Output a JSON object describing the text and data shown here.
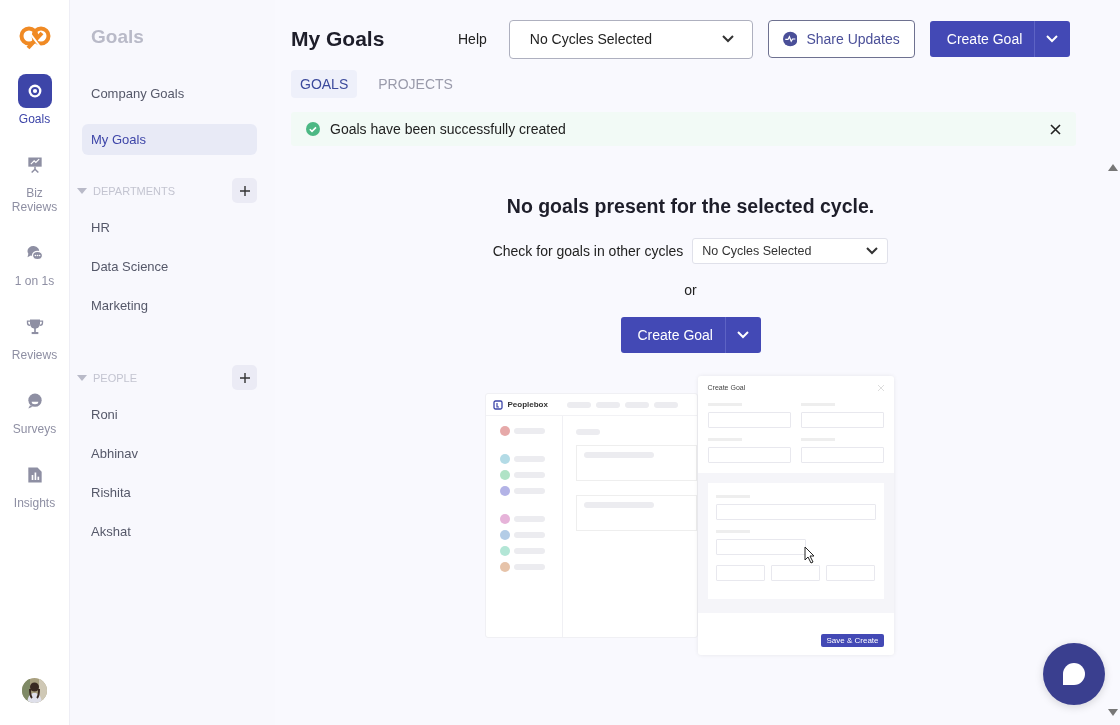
{
  "rail": {
    "items": [
      {
        "label": "Goals",
        "kind": "target",
        "selected": true
      },
      {
        "label": "Biz Reviews",
        "kind": "presentation",
        "selected": false
      },
      {
        "label": "1 on 1s",
        "kind": "chat",
        "selected": false
      },
      {
        "label": "Reviews",
        "kind": "trophy",
        "selected": false
      },
      {
        "label": "Surveys",
        "kind": "survey",
        "selected": false
      },
      {
        "label": "Insights",
        "kind": "chart",
        "selected": false
      }
    ]
  },
  "sidebar": {
    "title": "Goals",
    "items": [
      {
        "label": "Company Goals",
        "selected": false
      },
      {
        "label": "My Goals",
        "selected": true
      }
    ],
    "sections": [
      {
        "title": "DEPARTMENTS",
        "expanded": true,
        "items": [
          "HR",
          "Data Science",
          "Marketing"
        ]
      },
      {
        "title": "PEOPLE",
        "expanded": true,
        "items": [
          "Roni",
          "Abhinav",
          "Rishita",
          "Akshat"
        ]
      }
    ]
  },
  "header": {
    "title": "My Goals",
    "help": "Help",
    "cycle_select": "No Cycles Selected",
    "share_button": "Share Updates",
    "create_button": "Create Goal"
  },
  "tabs": [
    {
      "label": "GOALS",
      "selected": true
    },
    {
      "label": "PROJECTS",
      "selected": false
    }
  ],
  "alert": {
    "message": "Goals have been successfully created"
  },
  "empty_state": {
    "heading": "No goals present for the selected cycle.",
    "prompt": "Check for goals in other cycles",
    "cycle_select": "No Cycles Selected",
    "or": "or",
    "create_button": "Create Goal"
  },
  "illustration": {
    "brand": "Peoplebox",
    "dialog_title": "Create Goal",
    "save_button": "Save & Create",
    "dots": [
      {
        "color": "#e6a9a9"
      },
      {
        "color": "#b3dbe6"
      },
      {
        "color": "#b0e3c6"
      },
      {
        "color": "#b3b3e6"
      },
      {
        "color": "#e6b3d9"
      },
      {
        "color": "#b3cce6"
      },
      {
        "color": "#b3e6d6"
      },
      {
        "color": "#e6c3a9"
      }
    ]
  }
}
